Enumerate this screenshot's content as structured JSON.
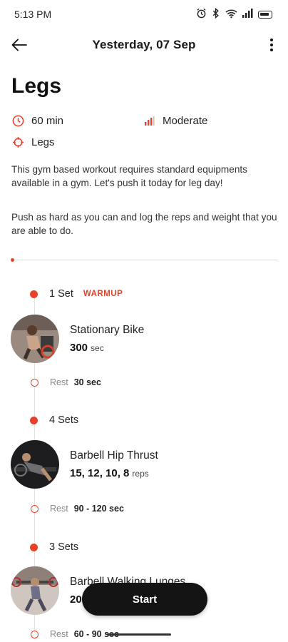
{
  "status_bar": {
    "time": "5:13 PM"
  },
  "header": {
    "title": "Yesterday, 07 Sep"
  },
  "workout": {
    "title": "Legs",
    "duration": "60 min",
    "intensity": "Moderate",
    "muscle_group": "Legs",
    "description_1": "This gym based workout requires standard equipments available in a gym. Let's push it today for leg day!",
    "description_2": "Push as hard as you can and log the reps and weight that you are able to do."
  },
  "exercises": [
    {
      "sets": "1 Set",
      "tag": "WARMUP",
      "name": "Stationary Bike",
      "metric": "300",
      "unit": "sec",
      "rest_label": "Rest",
      "rest_value": "30 sec"
    },
    {
      "sets": "4 Sets",
      "tag": "",
      "name": "Barbell Hip Thrust",
      "metric": "15, 12, 10, 8",
      "unit": "reps",
      "rest_label": "Rest",
      "rest_value": "90 - 120 sec"
    },
    {
      "sets": "3 Sets",
      "tag": "",
      "name": "Barbell Walking Lunges",
      "metric": "20",
      "unit": "",
      "rest_label": "Rest",
      "rest_value": "60 - 90 sec"
    }
  ],
  "actions": {
    "start_label": "Start"
  },
  "colors": {
    "accent": "#e8412b",
    "button_dark": "#141414"
  },
  "icons": [
    "back-arrow-icon",
    "more-vertical-icon",
    "clock-icon",
    "intensity-bars-icon",
    "target-icon",
    "alarm-icon",
    "bluetooth-icon",
    "wifi-icon",
    "signal-icon",
    "battery-icon"
  ]
}
